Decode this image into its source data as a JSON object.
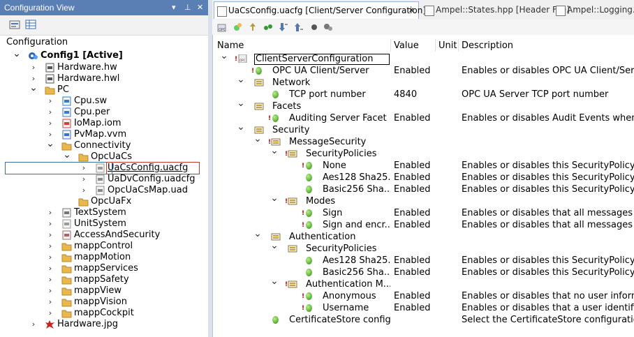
{
  "left_panel": {
    "title": "Configuration View",
    "title_buttons": [
      "▾",
      "⊥",
      "✕"
    ],
    "label": "Configuration",
    "tree": [
      {
        "label": "Config1 [Active]",
        "chev": "⌄",
        "icon": "config-icon",
        "bold": true
      },
      {
        "label": "Hardware.hw",
        "chev": "›",
        "icon": "hardware-icon"
      },
      {
        "label": "Hardware.hwl",
        "chev": "›",
        "icon": "hardware-icon"
      },
      {
        "label": "PC",
        "chev": "⌄",
        "icon": "folder-icon"
      },
      {
        "label": "Cpu.sw",
        "chev": "›",
        "icon": "software-icon"
      },
      {
        "label": "Cpu.per",
        "chev": "›",
        "icon": "permanent-icon"
      },
      {
        "label": "IoMap.iom",
        "chev": "›",
        "icon": "iomap-icon"
      },
      {
        "label": "PvMap.vvm",
        "chev": "›",
        "icon": "pvmap-icon"
      },
      {
        "label": "Connectivity",
        "chev": "⌄",
        "icon": "folder-icon"
      },
      {
        "label": "OpcUaCs",
        "chev": "⌄",
        "icon": "folder-icon"
      },
      {
        "label": "UaCsConfig.uacfg",
        "chev": "›",
        "icon": "opc-file-icon",
        "selected": true
      },
      {
        "label": "UaDvConfig.uadcfg",
        "chev": "›",
        "icon": "file-icon"
      },
      {
        "label": "OpcUaCsMap.uad",
        "chev": "›",
        "icon": "file-icon"
      },
      {
        "label": "OpcUaFx",
        "chev": "",
        "icon": "folder-icon"
      },
      {
        "label": "TextSystem",
        "chev": "›",
        "icon": "text-system-icon"
      },
      {
        "label": "UnitSystem",
        "chev": "›",
        "icon": "unit-system-icon"
      },
      {
        "label": "AccessAndSecurity",
        "chev": "›",
        "icon": "security-icon"
      },
      {
        "label": "mappControl",
        "chev": "›",
        "icon": "folder-icon"
      },
      {
        "label": "mappMotion",
        "chev": "›",
        "icon": "folder-icon"
      },
      {
        "label": "mappServices",
        "chev": "›",
        "icon": "folder-icon"
      },
      {
        "label": "mappSafety",
        "chev": "›",
        "icon": "folder-icon"
      },
      {
        "label": "mappView",
        "chev": "›",
        "icon": "folder-icon"
      },
      {
        "label": "mappVision",
        "chev": "›",
        "icon": "folder-icon"
      },
      {
        "label": "mappCockpit",
        "chev": "›",
        "icon": "folder-icon"
      },
      {
        "label": "Hardware.jpg",
        "chev": "›",
        "icon": "image-icon"
      }
    ]
  },
  "tabs": [
    {
      "label": "UaCsConfig.uacfg [Client/Server Configuration]",
      "close": "✕",
      "active": true
    },
    {
      "label": "Ampel::States.hpp [Header File]",
      "active": false
    },
    {
      "label": "Ampel::Logging.hp",
      "active": false
    }
  ],
  "grid": {
    "headers": {
      "name": "Name",
      "value": "Value",
      "unit": "Unit",
      "description": "Description"
    },
    "rows": [
      {
        "name": "ClientServerConfiguration",
        "value": "",
        "description": "",
        "kind": "root",
        "chev": "⌄",
        "excl": true
      },
      {
        "name": "OPC UA Client/Server",
        "value": "Enabled",
        "description": "Enables or disables OPC UA Client/Server",
        "kind": "param",
        "excl": true
      },
      {
        "name": "Network",
        "value": "",
        "description": "",
        "kind": "group",
        "chev": "⌄"
      },
      {
        "name": "TCP port number",
        "value": "4840",
        "description": "OPC UA Server TCP port number",
        "kind": "param"
      },
      {
        "name": "Facets",
        "value": "",
        "description": "",
        "kind": "group",
        "chev": "⌄"
      },
      {
        "name": "Auditing Server Facet",
        "value": "Enabled",
        "description": "Enables or disables Audit Events when an c",
        "kind": "param",
        "excl": true
      },
      {
        "name": "Security",
        "value": "",
        "description": "",
        "kind": "group",
        "chev": "⌄"
      },
      {
        "name": "MessageSecurity",
        "value": "",
        "description": "",
        "kind": "group",
        "chev": "⌄",
        "excl": true
      },
      {
        "name": "SecurityPolicies",
        "value": "",
        "description": "",
        "kind": "group",
        "chev": "⌄",
        "excl": true
      },
      {
        "name": "None",
        "value": "Enabled",
        "description": "Enables or disables this SecurityPolicy for c",
        "kind": "param",
        "excl": true
      },
      {
        "name": "Aes128 Sha25...",
        "value": "Enabled",
        "description": "Enables or disables this SecurityPolicy for c",
        "kind": "param"
      },
      {
        "name": "Basic256 Sha...",
        "value": "Enabled",
        "description": "Enables or disables this SecurityPolicy for c",
        "kind": "param"
      },
      {
        "name": "Modes",
        "value": "",
        "description": "",
        "kind": "group",
        "chev": "⌄",
        "excl": true
      },
      {
        "name": "Sign",
        "value": "Enabled",
        "description": "Enables or disables that all messages are s",
        "kind": "param",
        "excl": true
      },
      {
        "name": "Sign and encr...",
        "value": "Enabled",
        "description": "Enables or disables that all messages are s",
        "kind": "param",
        "excl": true
      },
      {
        "name": "Authentication",
        "value": "",
        "description": "",
        "kind": "group",
        "chev": "⌄"
      },
      {
        "name": "SecurityPolicies",
        "value": "",
        "description": "",
        "kind": "group",
        "chev": "⌄"
      },
      {
        "name": "Aes128 Sha25...",
        "value": "Enabled",
        "description": "Enables or disables this SecurityPolicy for c",
        "kind": "param"
      },
      {
        "name": "Basic256 Sha...",
        "value": "Enabled",
        "description": "Enables or disables this SecurityPolicy for c",
        "kind": "param"
      },
      {
        "name": "Authentication M...",
        "value": "",
        "description": "",
        "kind": "group",
        "chev": "⌄",
        "excl": true
      },
      {
        "name": "Anonymous",
        "value": "Enabled",
        "description": "Enables or disables that no user informatio",
        "kind": "param",
        "excl": true
      },
      {
        "name": "Username",
        "value": "Enabled",
        "description": "Enables or disables that a user identified b",
        "kind": "param",
        "excl": true
      },
      {
        "name": "CertificateStore config...",
        "value": "",
        "description": "Select the CertificateStore configuration us",
        "kind": "param"
      }
    ]
  },
  "colors": {
    "title_bar": "#5a7fb5",
    "selection_border": "#c0392b"
  }
}
